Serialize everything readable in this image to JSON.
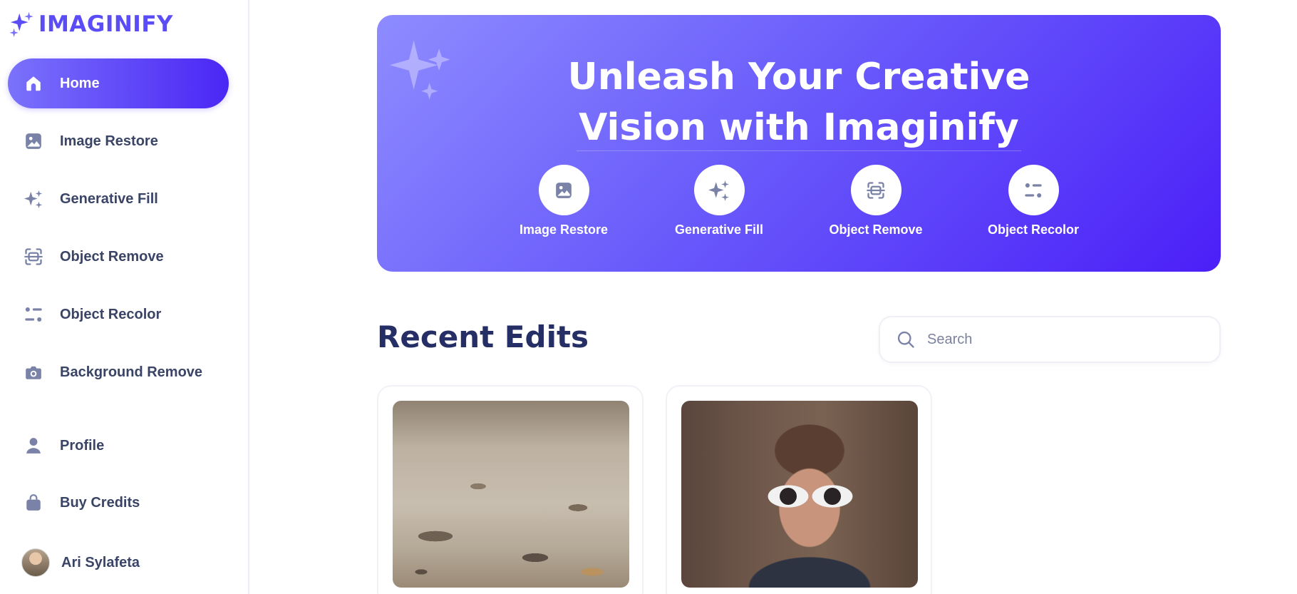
{
  "brand": {
    "name": "IMAGINIFY",
    "accent_color": "#5b4df5",
    "logo_icon": "sparkles-icon"
  },
  "sidebar": {
    "items": [
      {
        "label": "Home",
        "icon": "home-icon",
        "active": true
      },
      {
        "label": "Image Restore",
        "icon": "image-icon",
        "active": false
      },
      {
        "label": "Generative Fill",
        "icon": "sparkles-icon",
        "active": false
      },
      {
        "label": "Object Remove",
        "icon": "scan-icon",
        "active": false
      },
      {
        "label": "Object Recolor",
        "icon": "filter-icon",
        "active": false
      },
      {
        "label": "Background Remove",
        "icon": "camera-icon",
        "active": false
      }
    ],
    "secondary_items": [
      {
        "label": "Profile",
        "icon": "user-icon"
      },
      {
        "label": "Buy Credits",
        "icon": "bag-icon"
      }
    ],
    "user": {
      "name": "Ari Sylafeta"
    }
  },
  "hero": {
    "title_line1": "Unleash Your Creative",
    "title_line2": "Vision with Imaginify",
    "tools": [
      {
        "label": "Image Restore",
        "icon": "image-icon"
      },
      {
        "label": "Generative Fill",
        "icon": "sparkles-icon"
      },
      {
        "label": "Object Remove",
        "icon": "scan-icon"
      },
      {
        "label": "Object Recolor",
        "icon": "filter-icon"
      }
    ],
    "gradient_start": "#8e8cff",
    "gradient_end": "#4b1ff8"
  },
  "recent": {
    "title": "Recent Edits",
    "search_placeholder": "Search",
    "search_value": "",
    "cards": [
      {
        "image": "gravel-ground-image"
      },
      {
        "image": "person-with-white-sunglasses-image"
      }
    ]
  }
}
